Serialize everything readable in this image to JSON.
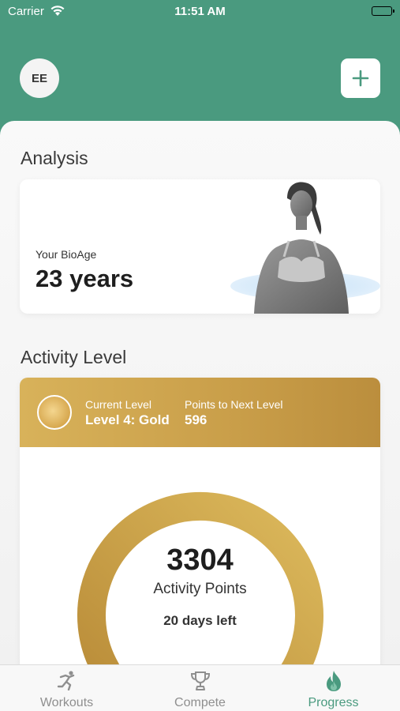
{
  "status_bar": {
    "carrier": "Carrier",
    "time": "11:51 AM"
  },
  "header": {
    "avatar_initials": "EE",
    "add_button": "add-icon"
  },
  "analysis": {
    "title": "Analysis",
    "bioage_label": "Your BioAge",
    "bioage_value": "23 years"
  },
  "activity": {
    "title": "Activity Level",
    "current_level_label": "Current Level",
    "current_level_value": "Level 4: Gold",
    "next_level_label": "Points to Next Level",
    "next_level_value": "596",
    "points": "3304",
    "points_label": "Activity Points",
    "days_left": "20 days left",
    "progress_fraction": 0.85
  },
  "tabs": [
    {
      "label": "Workouts",
      "icon": "runner-icon",
      "active": false
    },
    {
      "label": "Compete",
      "icon": "trophy-icon",
      "active": false
    },
    {
      "label": "Progress",
      "icon": "flame-icon",
      "active": true
    }
  ],
  "colors": {
    "brand_green": "#4a9a7f",
    "gold": "#c99e49",
    "gold_light": "#f5ecd7"
  }
}
